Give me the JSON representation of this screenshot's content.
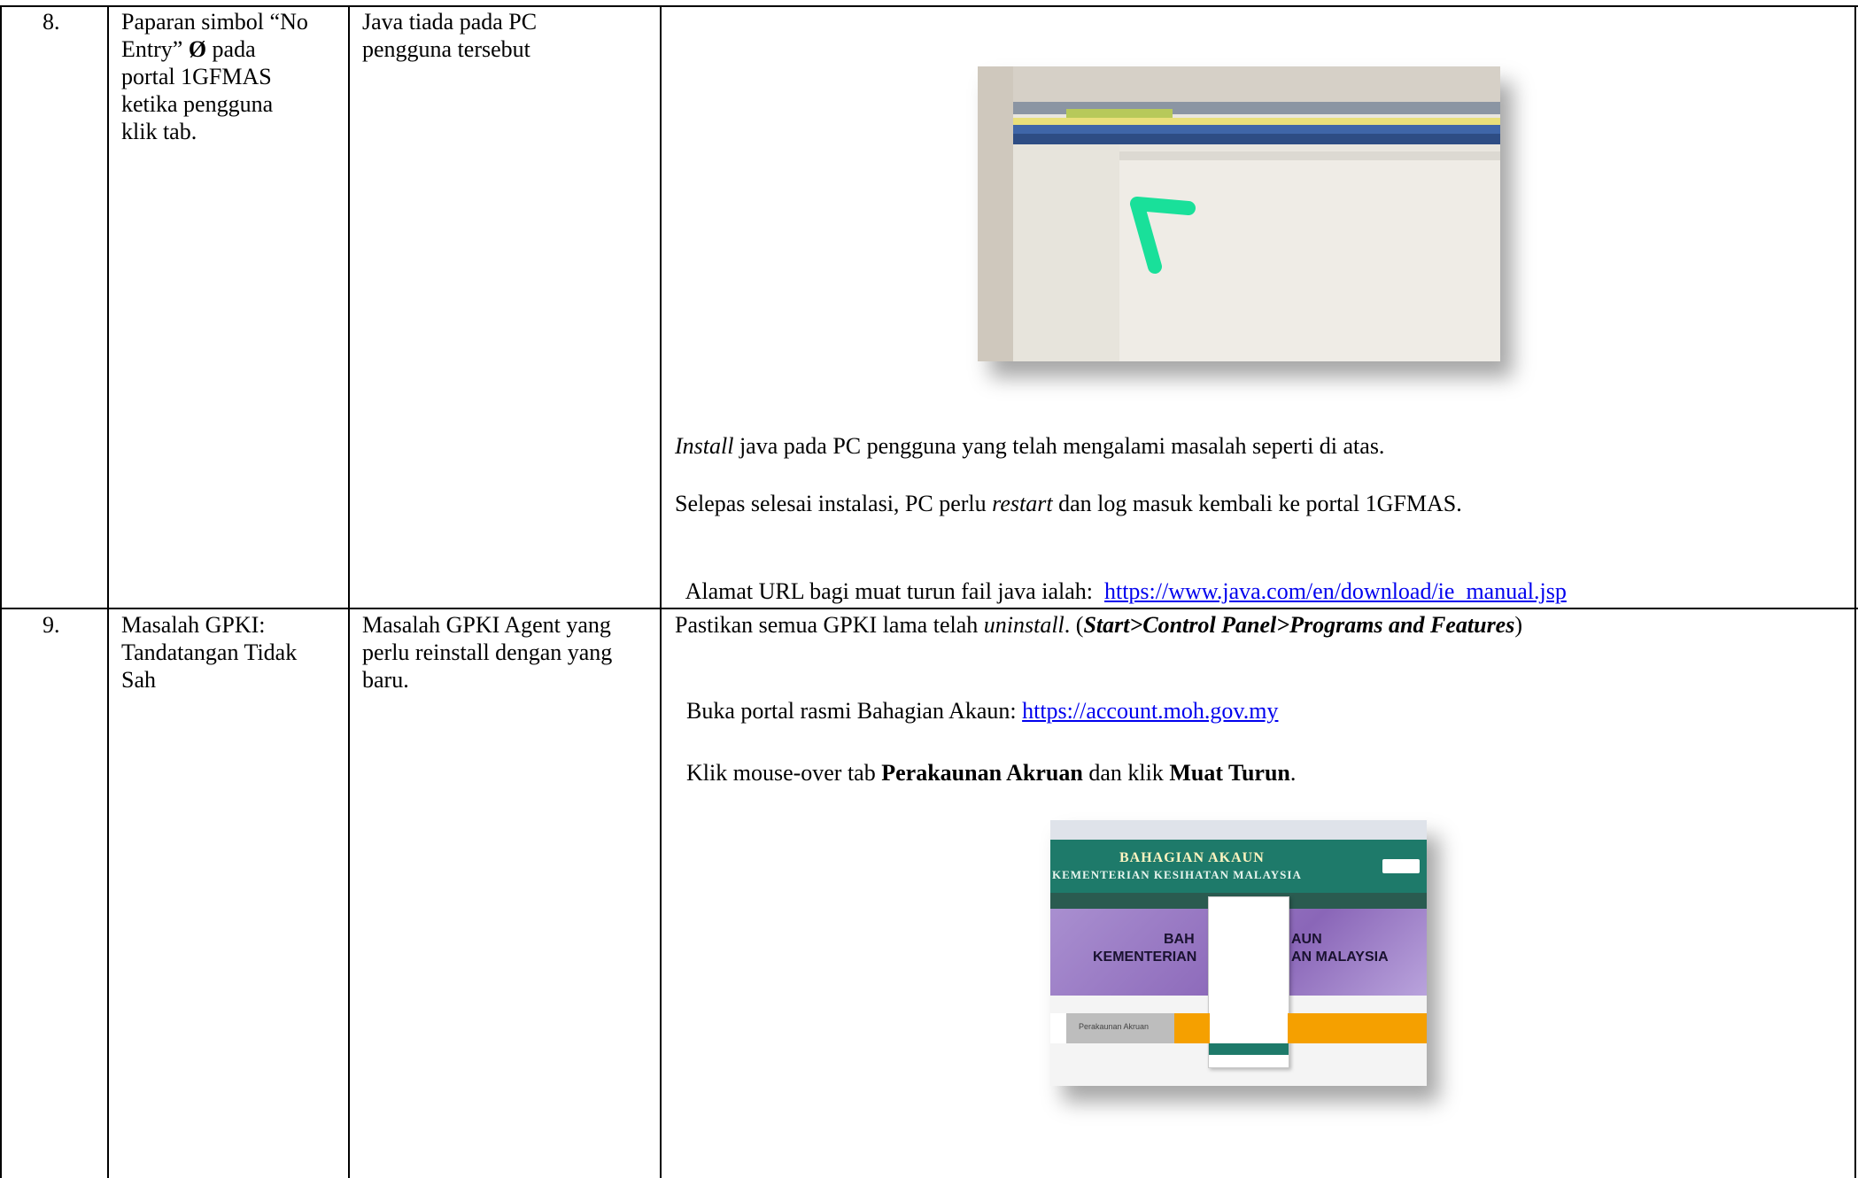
{
  "rows": [
    {
      "num": "8.",
      "problem_lines": [
        "Paparan simbol “No",
        "portal 1GFMAS",
        "ketika pengguna",
        "klik tab."
      ],
      "problem_entry_prefix": "Entry”",
      "problem_symbol": "Ø",
      "problem_entry_suffix": "pada",
      "cause_lines": [
        "Java tiada pada PC",
        "pengguna tersebut"
      ],
      "solution": {
        "p1_italic": "Install",
        "p1_rest": " java pada PC pengguna yang telah mengalami masalah seperti di atas.",
        "p2_pre": "Selepas selesai instalasi, PC perlu ",
        "p2_italic": "restart",
        "p2_post": " dan log masuk kembali ke portal 1GFMAS.",
        "p3_pre": "Alamat URL bagi muat turun fail java ialah:  ",
        "p3_link": "https://www.java.com/en/download/ie_manual.jsp"
      }
    },
    {
      "num": "9.",
      "problem_lines": [
        "Masalah GPKI:",
        "Tandatangan Tidak",
        "Sah"
      ],
      "cause_lines": [
        "Masalah GPKI Agent yang",
        "perlu reinstall dengan yang",
        "baru."
      ],
      "solution": {
        "p1_pre": "Pastikan semua GPKI lama telah ",
        "p1_italic": "uninstall",
        "p1_mid": ". (",
        "p1_bolditalic": "Start>Control Panel>Programs and Features",
        "p1_post": ")",
        "p2_pre": "Buka portal rasmi Bahagian Akaun: ",
        "p2_link": "https://account.moh.gov.my",
        "p3_pre": "Klik mouse-over tab ",
        "p3_bold1": "Perakaunan Akruan",
        "p3_mid": " dan klik ",
        "p3_bold2": "Muat Turun",
        "p3_post": "."
      }
    }
  ],
  "screenshot2": {
    "header_line1": "BAHAGIAN AKAUN",
    "header_line2": "KEMENTERIAN KESIHATAN MALAYSIA",
    "banner_line1": "BAH",
    "banner_line1b": "AUN",
    "banner_line2": "KEMENTERIAN",
    "banner_line2b": "AN MALAYSIA",
    "button": "Perakaunan Akruan"
  },
  "colors": {
    "link": "#0000ee",
    "arrow": "#19e09a",
    "header_teal": "#1e7a6a",
    "banner_purple": "#9b7bc4",
    "orange": "#f5a000"
  }
}
